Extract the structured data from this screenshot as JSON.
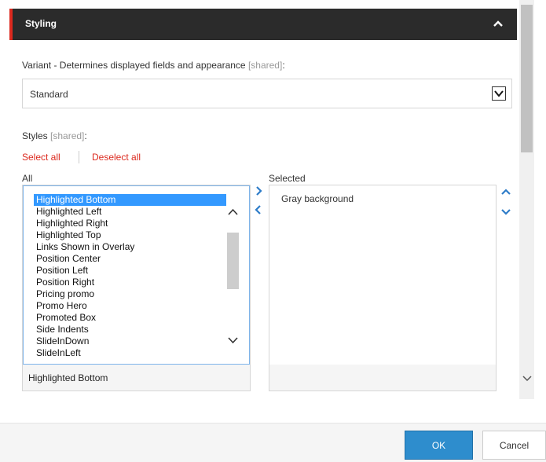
{
  "section": {
    "title": "Styling",
    "toggle_icon": "chevron-up-icon"
  },
  "variant": {
    "label": "Variant - Determines displayed fields and appearance",
    "shared": "[shared]",
    "colon": ":",
    "value": "Standard"
  },
  "styles": {
    "label": "Styles",
    "shared": "[shared]",
    "colon": ":"
  },
  "actions": {
    "select_all": "Select all",
    "deselect_all": "Deselect all"
  },
  "all_list": {
    "label": "All",
    "items": [
      "Highlighted Bottom",
      "Highlighted Left",
      "Highlighted Right",
      "Highlighted Top",
      "Links Shown in Overlay",
      "Position Center",
      "Position Left",
      "Position Right",
      "Pricing promo",
      "Promo Hero",
      "Promoted Box",
      "Side Indents",
      "SlideInDown",
      "SlideInLeft"
    ],
    "selected_item": "Highlighted Bottom",
    "current_value": "Highlighted Bottom"
  },
  "selected_list": {
    "label": "Selected",
    "items": [
      "Gray background"
    ]
  },
  "footer": {
    "ok_label": "OK",
    "cancel_label": "Cancel"
  },
  "colors": {
    "accent": "#dc291e",
    "header_bg": "#2b2b2b",
    "primary_button": "#2e8dcd",
    "selection": "#3399ff",
    "link": "#dc291e",
    "move_arrow": "#2e7cc8"
  }
}
